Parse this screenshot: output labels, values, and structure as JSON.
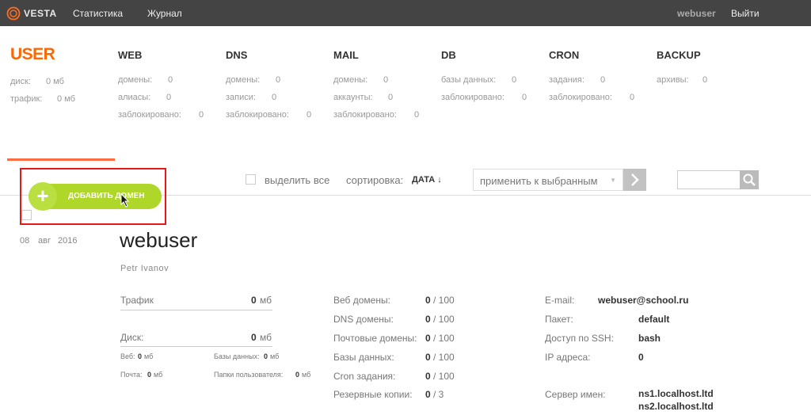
{
  "topbar": {
    "logo": "VESTA",
    "nav": [
      "Статистика",
      "Журнал"
    ],
    "user": "webuser",
    "logout": "Выйти"
  },
  "menu": {
    "user": {
      "title": "USER",
      "disk_label": "диск:",
      "disk_value": "0 мб",
      "traffic_label": "трафик:",
      "traffic_value": "0 мб"
    },
    "web": {
      "title": "WEB",
      "stats": [
        [
          "домены:",
          "0"
        ],
        [
          "алиасы:",
          "0"
        ],
        [
          "заблокировано:",
          "0"
        ]
      ]
    },
    "dns": {
      "title": "DNS",
      "stats": [
        [
          "домены:",
          "0"
        ],
        [
          "записи:",
          "0"
        ],
        [
          "заблокировано:",
          "0"
        ]
      ]
    },
    "mail": {
      "title": "MAIL",
      "stats": [
        [
          "домены:",
          "0"
        ],
        [
          "аккаунты:",
          "0"
        ],
        [
          "заблокировано:",
          "0"
        ]
      ]
    },
    "db": {
      "title": "DB",
      "stats": [
        [
          "базы данных:",
          "0"
        ],
        [
          "заблокировано:",
          "0"
        ]
      ]
    },
    "cron": {
      "title": "CRON",
      "stats": [
        [
          "задания:",
          "0"
        ],
        [
          "заблокировано:",
          "0"
        ]
      ]
    },
    "backup": {
      "title": "BACKUP",
      "stats": [
        [
          "архивы:",
          "0"
        ]
      ]
    }
  },
  "toolbar": {
    "add_label": "ДОБАВИТЬ ДОМЕН",
    "select_all": "выделить все",
    "sort_label": "сортировка:",
    "sort_value": "ДАТА ↓",
    "action_select": "применить к выбранным",
    "search_placeholder": ""
  },
  "user_card": {
    "date_day": "08",
    "date_month": "авг",
    "date_year": "2016",
    "username": "webuser",
    "full_name": "Petr Ivanov",
    "traffic_label": "Трафик",
    "traffic_value": "0",
    "traffic_unit": "мб",
    "disk_label": "Диск:",
    "disk_value": "0",
    "disk_unit": "мб",
    "disk_breakdown": {
      "web_label": "Веб:",
      "web_value": "0",
      "web_unit": "мб",
      "db_label": "Базы данных:",
      "db_value": "0",
      "db_unit": "мб",
      "mail_label": "Почта:",
      "mail_value": "0",
      "mail_unit": "мб",
      "dirs_label": "Папки пользователя:",
      "dirs_value": "0",
      "dirs_unit": "мб"
    },
    "limits": [
      [
        "Веб домены:",
        "0",
        "/ 100"
      ],
      [
        "DNS домены:",
        "0",
        "/ 100"
      ],
      [
        "Почтовые домены:",
        "0",
        "/ 100"
      ],
      [
        "Базы данных:",
        "0",
        "/ 100"
      ],
      [
        "Cron задания:",
        "0",
        "/ 100"
      ],
      [
        "Резервные копии:",
        "0",
        "/ 3"
      ]
    ],
    "info": {
      "email_label": "E-mail:",
      "email_value": "webuser@school.ru",
      "package_label": "Пакет:",
      "package_value": "default",
      "ssh_label": "Доступ по SSH:",
      "ssh_value": "bash",
      "ip_label": "IP адреса:",
      "ip_value": "0",
      "ns_label": "Сервер имен:",
      "ns1": "ns1.localhost.ltd",
      "ns2": "ns2.localhost.ltd"
    }
  },
  "colors": {
    "accent": "#ff6701",
    "add_button": "#aed72a",
    "highlight": "#e5181a",
    "topbar": "#444444"
  }
}
